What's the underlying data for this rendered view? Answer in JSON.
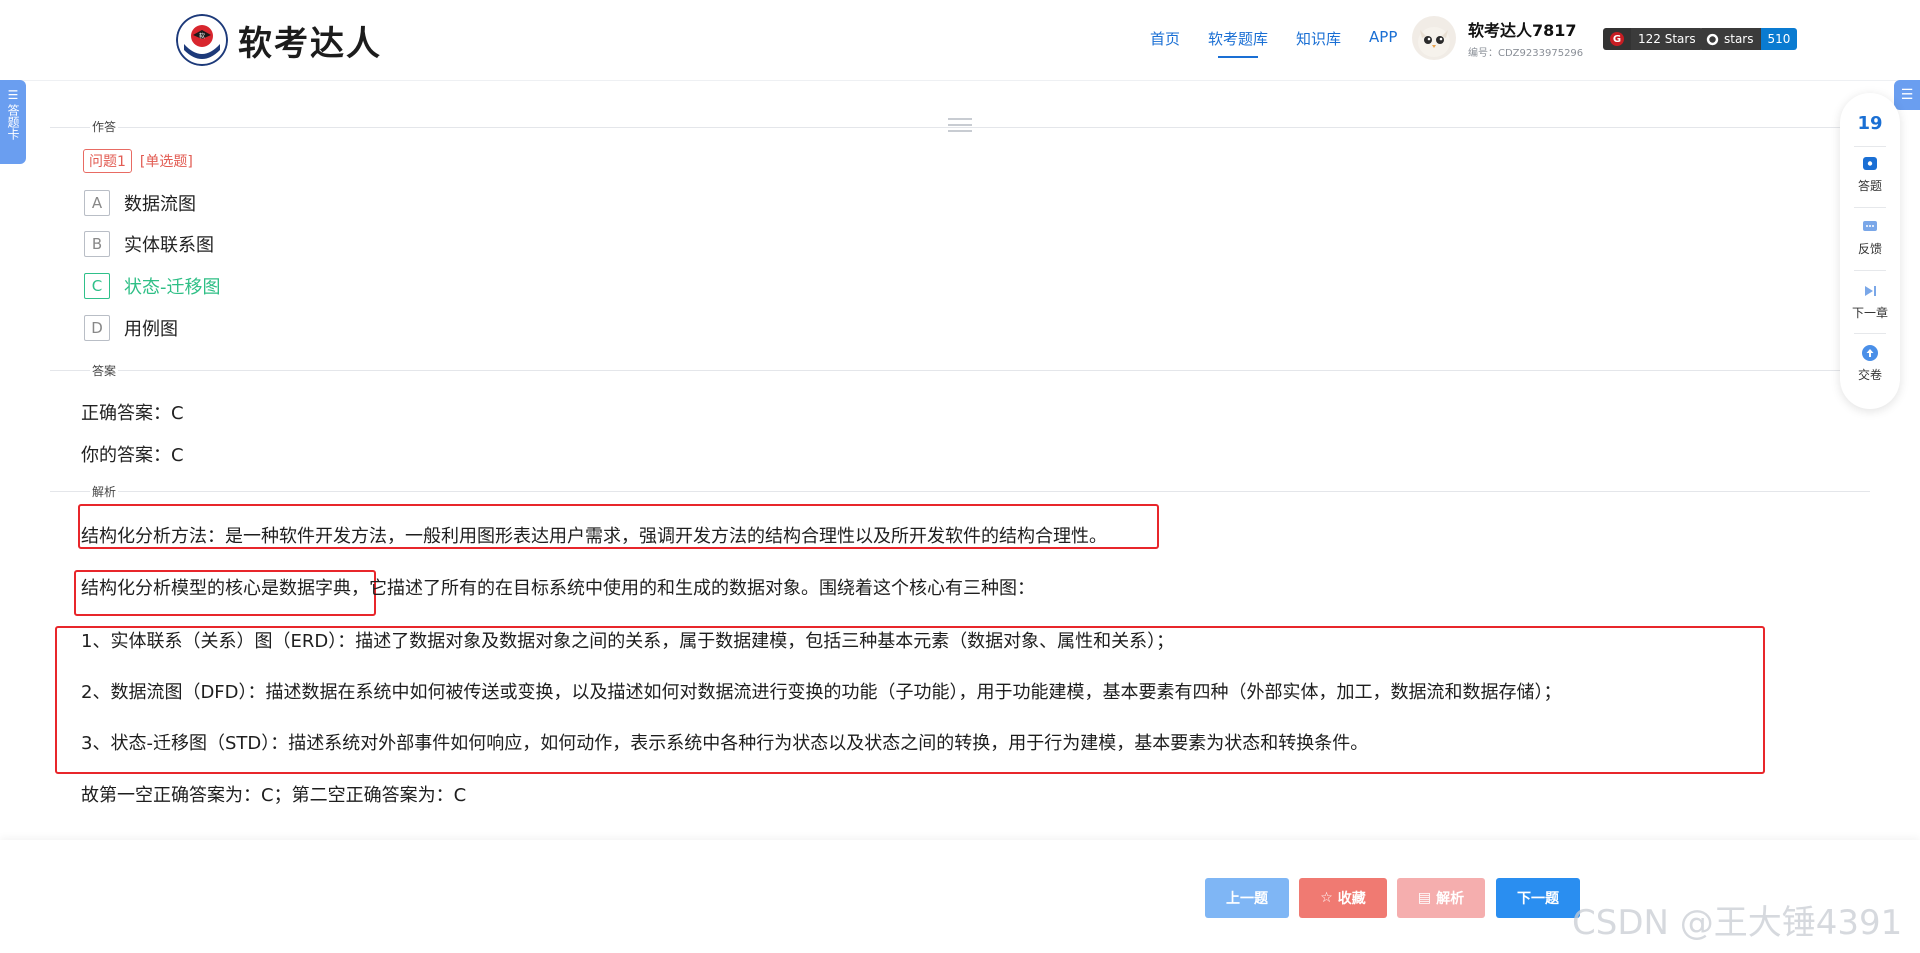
{
  "header": {
    "logo_text": "软考达人",
    "nav": [
      "首页",
      "软考题库",
      "知识库",
      "APP"
    ],
    "active_nav": "软考题库",
    "user": {
      "name": "软考达人7817",
      "id": "编号：CDZ9233975296"
    },
    "badges": {
      "gitee": {
        "left": "G",
        "right": "122 Stars"
      },
      "github": {
        "left": "stars",
        "right": "510"
      }
    }
  },
  "sidebar_tab": {
    "label": "答题卡"
  },
  "sections": {
    "answer_section": "作答",
    "result_section": "答案",
    "analysis_section": "解析"
  },
  "question": {
    "number_tag": "问题1",
    "type_tag": "[单选题]",
    "options": [
      {
        "letter": "A",
        "text": "数据流图"
      },
      {
        "letter": "B",
        "text": "实体联系图"
      },
      {
        "letter": "C",
        "text": "状态-迁移图"
      },
      {
        "letter": "D",
        "text": "用例图"
      }
    ],
    "correct": "C"
  },
  "answers": {
    "correct_label": "正确答案：C",
    "yours_label": "你的答案：C"
  },
  "analysis": {
    "p1": "结构化分析方法：是一种软件开发方法，一般利用图形表达用户需求，强调开发方法的结构合理性以及所开发软件的结构合理性。",
    "p2_highlight": "结构化分析模型的核心是数据字典，",
    "p2_rest": "它描述了所有的在目标系统中使用的和生成的数据对象。围绕着这个核心有三种图：",
    "item1": "1、实体联系（关系）图（ERD）：描述了数据对象及数据对象之间的关系，属于数据建模，包括三种基本元素（数据对象、属性和关系）；",
    "item2": "2、数据流图（DFD）：描述数据在系统中如何被传送或变换，以及描述如何对数据流进行变换的功能（子功能），用于功能建模，基本要素有四种（外部实体，加工，数据流和数据存储）；",
    "item3": "3、状态-迁移图（STD）：描述系统对外部事件如何响应，如何动作，表示系统中各种行为状态以及状态之间的转换，用于行为建模，基本要素为状态和转换条件。",
    "conclusion": "故第一空正确答案为：C；第二空正确答案为：C"
  },
  "float_panel": {
    "count": "19",
    "items": [
      "答题",
      "反馈",
      "下一章",
      "交卷"
    ]
  },
  "bottom": {
    "prev": "上一题",
    "fav": "收藏",
    "analysis": "解析",
    "next": "下一题"
  },
  "watermark": "CSDN @王大锤4391",
  "colors": {
    "accent": "#1a6fd4",
    "correct": "#2fbf86",
    "highlight_box": "#e8262b",
    "tag": "#e25b52"
  }
}
